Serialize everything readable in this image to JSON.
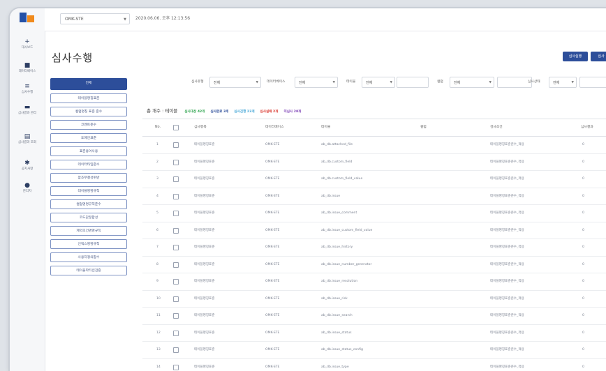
{
  "top": {
    "system_select": "OMK-STE",
    "datetime": "2020.06.06. 오후 12:13:56"
  },
  "nav": [
    {
      "icon": "plus-icon",
      "label": "대시보드"
    },
    {
      "icon": "folder-icon",
      "label": "데이터베이스"
    },
    {
      "icon": "list-icon",
      "label": "심사수행"
    },
    {
      "icon": "chart-icon",
      "label": "심사결과 관리"
    },
    {
      "icon": "report-icon",
      "label": "심사결과 조회"
    },
    {
      "icon": "gear-icon",
      "label": "공지사항"
    },
    {
      "icon": "user-icon",
      "label": "관리자"
    }
  ],
  "page": {
    "title": "심사수행",
    "btn1": "심사실행",
    "btn2": "심사"
  },
  "categories": [
    "전체",
    "테이블명칭표준",
    "컬럼명칭 표준 준수",
    "코멘트준수",
    "도메인표준",
    "표준용어사용",
    "데이터타입준수",
    "참조무결성위반",
    "테이블명명규칙",
    "컬럼명명규칙준수",
    "코드값정합성",
    "제약조건명명규칙",
    "인덱스명명규칙",
    "사용자정의함수",
    "테이블파티션검증"
  ],
  "filters": {
    "f1_label": "심사유형",
    "f1_value": "전체",
    "f2_label": "데이터베이스",
    "f2_value": "전체",
    "f3_label": "테이블",
    "f3_value": "전체",
    "f4_label": "컬럼",
    "f4_value": "전체",
    "f5_label": "심사상태",
    "f5_value": "전체"
  },
  "summary": {
    "total": "총 개수 : 테이블",
    "legend": [
      {
        "text": "심사대상 42개",
        "color": "#2ea44f"
      },
      {
        "text": "심사완료 3개",
        "color": "#2d4e9a"
      },
      {
        "text": "심사진행 23개",
        "color": "#42a5d6"
      },
      {
        "text": "심사실패 2개",
        "color": "#d9342b"
      },
      {
        "text": "미심사 28개",
        "color": "#7b3fb5"
      }
    ]
  },
  "table": {
    "headers": [
      "No.",
      "",
      "심사항목",
      "데이터베이스",
      "테이블",
      "컬럼",
      "검사조건",
      "심사결과"
    ],
    "rows": [
      {
        "no": "1",
        "item": "테이블명칭표준",
        "db": "OMK-STE",
        "table": "ab_db.attached_file",
        "cond": "테이블명칭표준준수_적용",
        "result": "0"
      },
      {
        "no": "2",
        "item": "테이블명칭표준",
        "db": "OMK-STE",
        "table": "ab_db.custom_field",
        "cond": "테이블명칭표준준수_적용",
        "result": "0"
      },
      {
        "no": "3",
        "item": "테이블명칭표준",
        "db": "OMK-STE",
        "table": "ab_db.custom_field_value",
        "cond": "테이블명칭표준준수_적용",
        "result": "0"
      },
      {
        "no": "4",
        "item": "테이블명칭표준",
        "db": "OMK-STE",
        "table": "ab_db.issue",
        "cond": "테이블명칭표준준수_적용",
        "result": "0"
      },
      {
        "no": "5",
        "item": "테이블명칭표준",
        "db": "OMK-STE",
        "table": "ab_db.issue_comment",
        "cond": "테이블명칭표준준수_적용",
        "result": "0"
      },
      {
        "no": "6",
        "item": "테이블명칭표준",
        "db": "OMK-STE",
        "table": "ab_db.issue_custom_field_value",
        "cond": "테이블명칭표준준수_적용",
        "result": "0"
      },
      {
        "no": "7",
        "item": "테이블명칭표준",
        "db": "OMK-STE",
        "table": "ab_db.issue_history",
        "cond": "테이블명칭표준준수_적용",
        "result": "0"
      },
      {
        "no": "8",
        "item": "테이블명칭표준",
        "db": "OMK-STE",
        "table": "ab_db.issue_number_generator",
        "cond": "테이블명칭표준준수_적용",
        "result": "0"
      },
      {
        "no": "9",
        "item": "테이블명칭표준",
        "db": "OMK-STE",
        "table": "ab_db.issue_resolution",
        "cond": "테이블명칭표준준수_적용",
        "result": "0"
      },
      {
        "no": "10",
        "item": "테이블명칭표준",
        "db": "OMK-STE",
        "table": "ab_db.issue_risk",
        "cond": "테이블명칭표준준수_적용",
        "result": "0"
      },
      {
        "no": "11",
        "item": "테이블명칭표준",
        "db": "OMK-STE",
        "table": "ab_db.issue_search",
        "cond": "테이블명칭표준준수_적용",
        "result": "0"
      },
      {
        "no": "12",
        "item": "테이블명칭표준",
        "db": "OMK-STE",
        "table": "ab_db.issue_status",
        "cond": "테이블명칭표준준수_적용",
        "result": "0"
      },
      {
        "no": "13",
        "item": "테이블명칭표준",
        "db": "OMK-STE",
        "table": "ab_db.issue_status_config",
        "cond": "테이블명칭표준준수_적용",
        "result": "0"
      },
      {
        "no": "14",
        "item": "테이블명칭표준",
        "db": "OMK-STE",
        "table": "ab_db.issue_type",
        "cond": "테이블명칭표준준수_적용",
        "result": "0"
      }
    ]
  }
}
